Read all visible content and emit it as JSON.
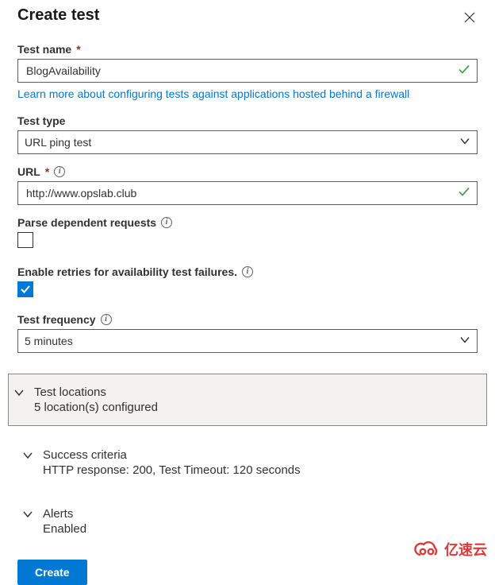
{
  "header": {
    "title": "Create test"
  },
  "fields": {
    "testName": {
      "label": "Test name",
      "value": "BlogAvailability"
    },
    "learnMoreLink": "Learn more about configuring tests against applications hosted behind a firewall",
    "testType": {
      "label": "Test type",
      "value": "URL ping test"
    },
    "url": {
      "label": "URL",
      "value": "http://www.opslab.club"
    },
    "parseDependent": {
      "label": "Parse dependent requests"
    },
    "enableRetries": {
      "label": "Enable retries for availability test failures."
    },
    "testFrequency": {
      "label": "Test frequency",
      "value": "5 minutes"
    }
  },
  "sections": {
    "testLocations": {
      "title": "Test locations",
      "subtitle": "5 location(s) configured"
    },
    "successCriteria": {
      "title": "Success criteria",
      "subtitle": "HTTP response: 200, Test Timeout: 120 seconds"
    },
    "alerts": {
      "title": "Alerts",
      "subtitle": "Enabled"
    }
  },
  "buttons": {
    "create": "Create"
  },
  "brand": {
    "text": "亿速云"
  }
}
